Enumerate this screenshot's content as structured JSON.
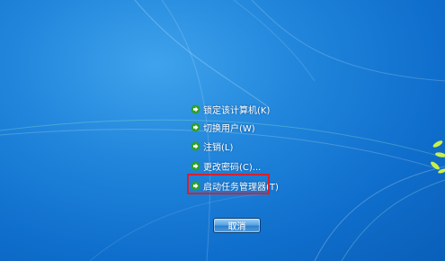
{
  "menu": {
    "items": [
      {
        "label": "锁定该计算机(K)",
        "icon": "green-arrow-icon"
      },
      {
        "label": "切换用户(W)",
        "icon": "green-arrow-icon"
      },
      {
        "label": "注销(L)",
        "icon": "green-arrow-icon"
      },
      {
        "label": "更改密码(C)...",
        "icon": "green-arrow-icon"
      },
      {
        "label": "启动任务管理器(T)",
        "icon": "green-arrow-icon"
      }
    ],
    "highlighted_index": 4,
    "highlight_color": "#d9202a"
  },
  "cancel_label": "取消",
  "colors": {
    "background": "#1f84da",
    "arrow_green": "#3bbf3b"
  }
}
